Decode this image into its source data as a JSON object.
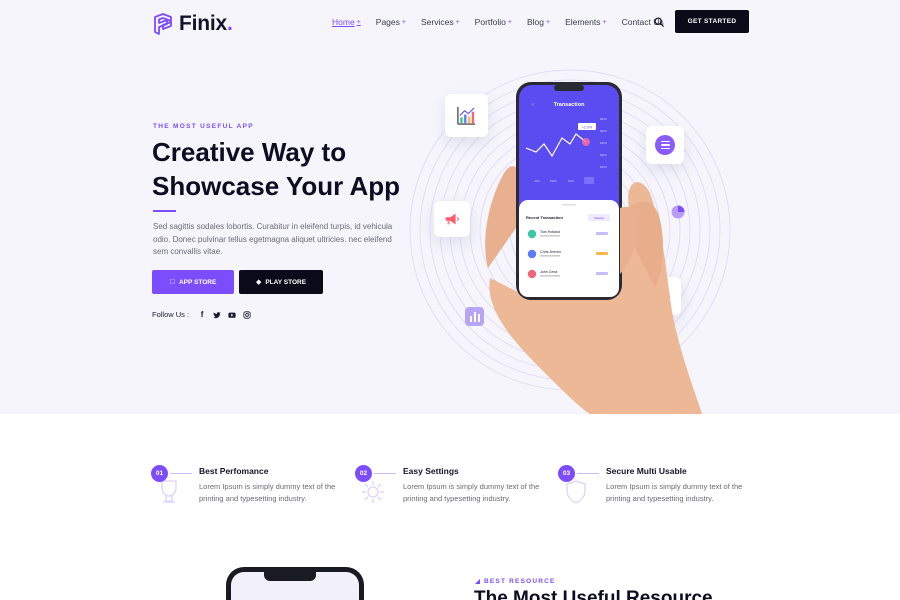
{
  "brand": {
    "name": "Finix",
    "dot": ".",
    "accent": "#7c4dff",
    "dark": "#0b0a18"
  },
  "nav": {
    "items": [
      {
        "label": "Home",
        "caret": "+"
      },
      {
        "label": "Pages",
        "caret": "+"
      },
      {
        "label": "Services",
        "caret": "+"
      },
      {
        "label": "Portfolio",
        "caret": "+"
      },
      {
        "label": "Blog",
        "caret": "+"
      },
      {
        "label": "Elements",
        "caret": "+"
      },
      {
        "label": "Contact Us"
      }
    ],
    "active": "Home",
    "search_icon": "search-icon",
    "cta_label": "GET STARTED"
  },
  "hero": {
    "eyebrow": "THE MOST USEFUL APP",
    "title": "Creative Way to Showcase Your App",
    "description": "Sed sagittis sodales lobortis. Curabitur in eleifend turpis, id vehicula odio. Donec pulvinar tellus egetmagna aliquet ultricies. nec eleifend sem convallis vitae.",
    "app_store_label": "APP STORE",
    "play_store_label": "PLAY STORE",
    "follow_label": "Follow Us :",
    "social_icons": [
      "facebook-icon",
      "twitter-icon",
      "youtube-icon",
      "instagram-icon"
    ]
  },
  "phone": {
    "screen_title": "Transaction",
    "chart_tag": "+2.9%",
    "recent_title": "Recent Transaction",
    "recent_filter": "Weekly",
    "transactions": [
      {
        "name": "Tom Holland"
      },
      {
        "name": "Chris Jericho"
      },
      {
        "name": "John Cena"
      }
    ]
  },
  "features": [
    {
      "number": "01",
      "title": "Best Perfomance",
      "description": "Lorem Ipsum is simply dummy text of the printing and typesetting industry."
    },
    {
      "number": "02",
      "title": "Easy Settings",
      "description": "Lorem Ipsum is simply dummy text of the printing and typesetting industry."
    },
    {
      "number": "03",
      "title": "Secure Multi Usable",
      "description": "Lorem Ipsum is simply dummy text of the printing and typesetting industry."
    }
  ],
  "resource": {
    "eyebrow": "BEST RESOURCE",
    "title": "The Most Useful Resource"
  }
}
